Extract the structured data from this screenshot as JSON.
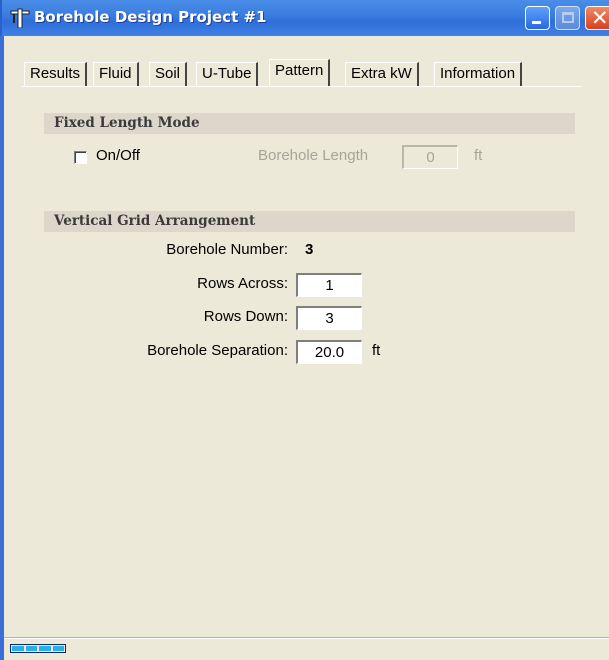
{
  "window": {
    "title": "Borehole Design Project #1",
    "controls": {
      "minimize": "minimize-icon",
      "maximize": "maximize-icon",
      "close": "close-icon"
    }
  },
  "tabs": [
    {
      "label": "Results"
    },
    {
      "label": "Fluid"
    },
    {
      "label": "Soil"
    },
    {
      "label": "U-Tube"
    },
    {
      "label": "Pattern"
    },
    {
      "label": "Extra kW"
    },
    {
      "label": "Information"
    }
  ],
  "active_tab": "Pattern",
  "fixed_length": {
    "header": "Fixed Length Mode",
    "toggle_label": "On/Off",
    "toggle_checked": false,
    "length_label": "Borehole Length",
    "length_value": "0",
    "length_unit": "ft"
  },
  "grid": {
    "header": "Vertical Grid Arrangement",
    "borehole_number_label": "Borehole Number:",
    "borehole_number_value": "3",
    "rows_across_label": "Rows Across:",
    "rows_across_value": "1",
    "rows_down_label": "Rows Down:",
    "rows_down_value": "3",
    "separation_label": "Borehole Separation:",
    "separation_value": "20.0",
    "separation_unit": "ft"
  },
  "colors": {
    "titlebar": "#3b7ee0",
    "face": "#ece9d8",
    "section_header": "#ddd6cb",
    "disabled_text": "#a7a49a",
    "progress": "#2ab0e8"
  }
}
